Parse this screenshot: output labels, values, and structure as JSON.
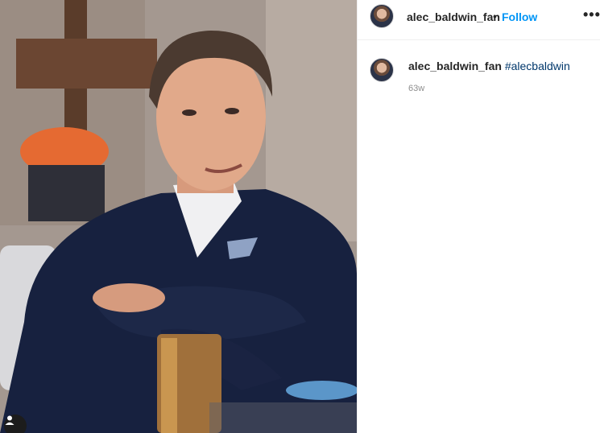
{
  "post": {
    "username": "alec_baldwin_fan",
    "follow_label": "Follow",
    "separator": "•",
    "more_label": "•••",
    "caption_username": "alec_baldwin_fan",
    "caption_hashtag": "#alecbaldwin",
    "timestamp": "63w"
  },
  "icons": {
    "avatar": "profile-avatar-icon",
    "tag_user": "user-tag-icon",
    "more": "more-options-icon"
  },
  "colors": {
    "follow": "#0095f6",
    "hashtag": "#00376b",
    "timestamp": "#8e8e8e"
  }
}
